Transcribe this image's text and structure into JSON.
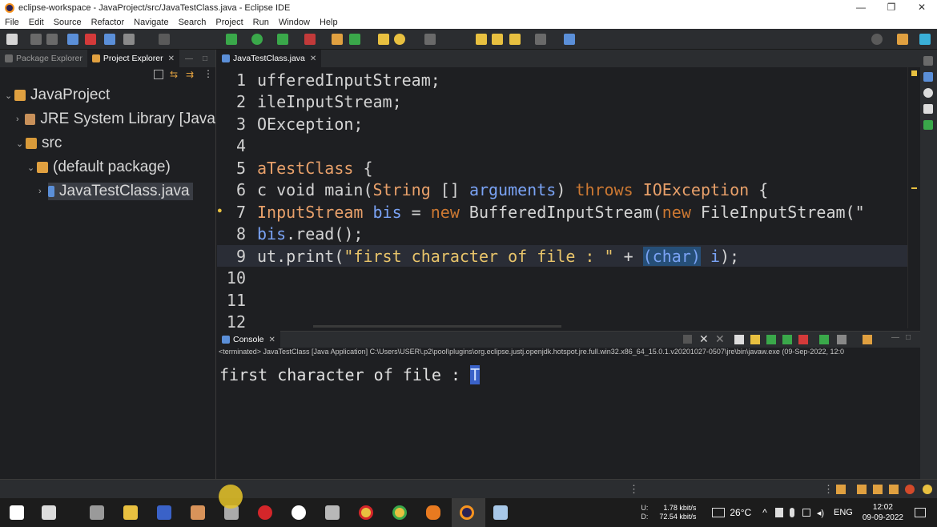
{
  "window": {
    "title": "eclipse-workspace - JavaProject/src/JavaTestClass.java - Eclipse IDE",
    "controls": [
      "—",
      "❐",
      "✕"
    ]
  },
  "menu": [
    "File",
    "Edit",
    "Source",
    "Refactor",
    "Navigate",
    "Search",
    "Project",
    "Run",
    "Window",
    "Help"
  ],
  "left_panel": {
    "tabs": [
      {
        "label": "Package Explorer",
        "active": false
      },
      {
        "label": "Project Explorer",
        "active": true
      }
    ],
    "tree": [
      {
        "label": "JavaProject",
        "depth": 0,
        "arrow": "⌄",
        "icon": "project-icon"
      },
      {
        "label": "JRE System Library [Java",
        "depth": 1,
        "arrow": "›",
        "icon": "library-icon"
      },
      {
        "label": "src",
        "depth": 1,
        "arrow": "⌄",
        "icon": "source-folder-icon"
      },
      {
        "label": "(default package)",
        "depth": 2,
        "arrow": "⌄",
        "icon": "package-icon"
      },
      {
        "label": "JavaTestClass.java",
        "depth": 3,
        "arrow": "›",
        "icon": "java-file-icon",
        "selected": true
      }
    ]
  },
  "editor": {
    "tab_label": "JavaTestClass.java",
    "lines": [
      {
        "n": "1",
        "parts": [
          [
            "ufferedInputStream;",
            "t"
          ]
        ]
      },
      {
        "n": "2",
        "parts": [
          [
            "ileInputStream;",
            "t"
          ]
        ]
      },
      {
        "n": "3",
        "parts": [
          [
            "OException;",
            "t"
          ]
        ]
      },
      {
        "n": "4",
        "parts": []
      },
      {
        "n": "5",
        "parts": [
          [
            "aTestClass",
            "cls"
          ],
          [
            " {",
            "t"
          ]
        ]
      },
      {
        "n": "6",
        "parts": [
          [
            "c void ",
            "t"
          ],
          [
            "main",
            "t"
          ],
          [
            "(",
            "t"
          ],
          [
            "String",
            "cls"
          ],
          [
            " [] ",
            "t"
          ],
          [
            "arguments",
            "var"
          ],
          [
            ") ",
            "t"
          ],
          [
            "throws",
            "kw"
          ],
          [
            " ",
            "t"
          ],
          [
            "IOException",
            "cls"
          ],
          [
            " {",
            "t"
          ]
        ]
      },
      {
        "n": "7",
        "parts": [
          [
            "InputStream",
            "cls"
          ],
          [
            " ",
            "t"
          ],
          [
            "bis",
            "var"
          ],
          [
            " = ",
            "t"
          ],
          [
            "new",
            "kw"
          ],
          [
            " BufferedInputStream(",
            "t"
          ],
          [
            "new",
            "kw"
          ],
          [
            " FileInputStream(\"",
            "t"
          ]
        ]
      },
      {
        "n": "8",
        "parts": [
          [
            "bis",
            "var"
          ],
          [
            ".read();",
            "t"
          ]
        ]
      },
      {
        "n": "9",
        "parts": [
          [
            "ut.print(",
            "t"
          ],
          [
            "\"first character of file : \"",
            "str"
          ],
          [
            " + ",
            "t"
          ],
          [
            "(char)",
            "sel"
          ],
          [
            " ",
            "t"
          ],
          [
            "i",
            "var"
          ],
          [
            ");",
            "t"
          ]
        ],
        "current": true
      },
      {
        "n": "10",
        "parts": []
      },
      {
        "n": "11",
        "parts": []
      },
      {
        "n": "12",
        "parts": []
      }
    ]
  },
  "console": {
    "tab_label": "Console",
    "status": "<terminated> JavaTestClass [Java Application] C:\\Users\\USER\\.p2\\pool\\plugins\\org.eclipse.justj.openjdk.hotspot.jre.full.win32.x86_64_15.0.1.v20201027-0507\\jre\\bin\\javaw.exe  (09-Sep-2022, 12:0",
    "output": "first character of file : ",
    "output_char": "T"
  },
  "taskbar": {
    "net_up": "1.78 kbit/s",
    "net_down": "72.54 kbit/s",
    "net_up_label": "U:",
    "net_down_label": "D:",
    "temperature": "26°C",
    "language": "ENG",
    "time": "12:02",
    "date": "09-09-2022"
  },
  "colors": {
    "accent": "#f7941e",
    "keyword": "#cc7832",
    "class": "#e8a06a",
    "variable": "#7aa3f5",
    "string": "#e8c46a"
  }
}
